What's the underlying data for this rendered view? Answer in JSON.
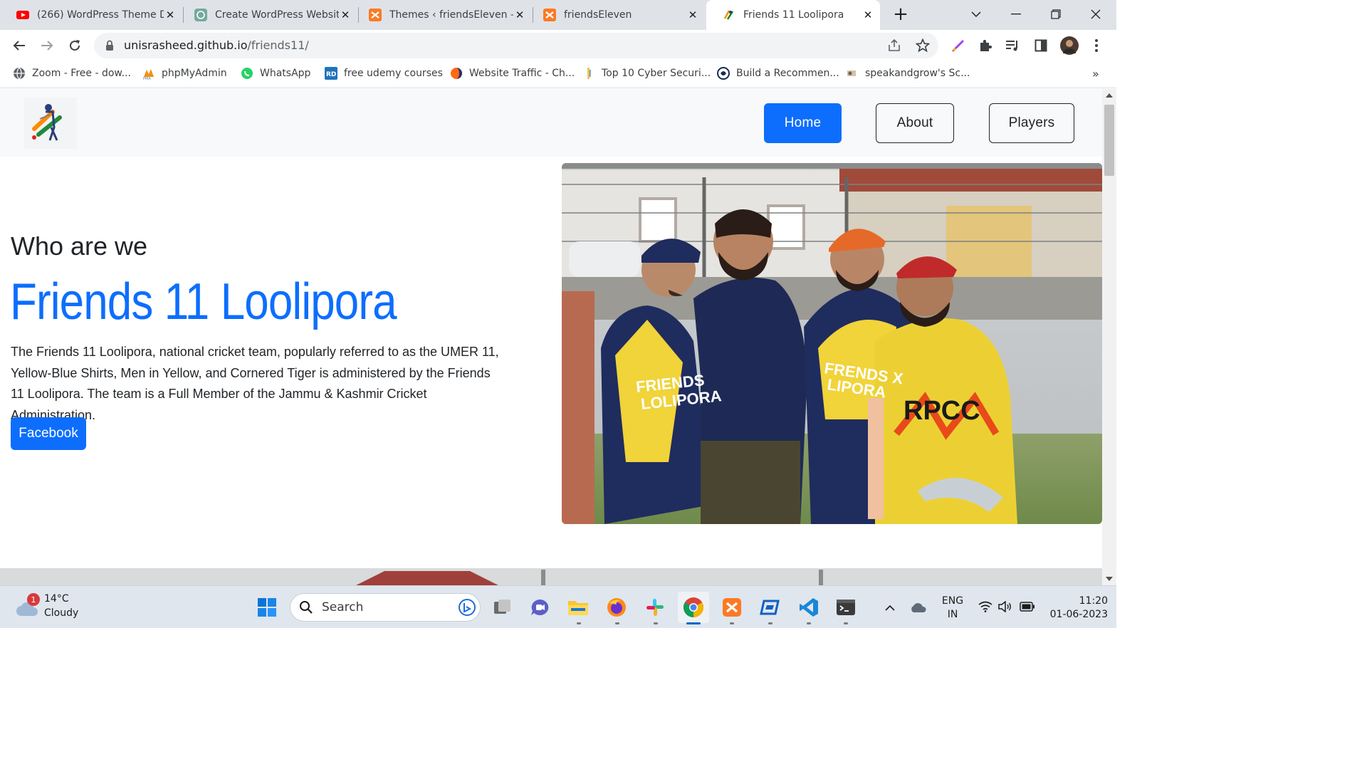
{
  "browser": {
    "tabs": [
      {
        "title": "(266) WordPress Theme D",
        "icon": "youtube-icon",
        "active": false
      },
      {
        "title": "Create WordPress Websit",
        "icon": "chatgpt-icon",
        "active": false
      },
      {
        "title": "Themes ‹ friendsEleven —",
        "icon": "xampp-icon",
        "active": false
      },
      {
        "title": "friendsEleven",
        "icon": "xampp-icon",
        "active": false
      },
      {
        "title": "Friends 11 Loolipora",
        "icon": "cricket-logo-icon",
        "active": true
      }
    ],
    "url_host": "unisrasheed.github.io",
    "url_path": "/friends11/",
    "bookmarks": [
      {
        "label": "Zoom - Free - dow...",
        "icon": "globe-icon"
      },
      {
        "label": "phpMyAdmin",
        "icon": "phpmyadmin-icon"
      },
      {
        "label": "WhatsApp",
        "icon": "whatsapp-icon"
      },
      {
        "label": "free udemy courses",
        "icon": "rd-icon"
      },
      {
        "label": "Website Traffic - Ch...",
        "icon": "traffic-icon"
      },
      {
        "label": "Top 10 Cyber Securi...",
        "icon": "bookmark-icon"
      },
      {
        "label": "Build a Recommen...",
        "icon": "codepen-icon"
      },
      {
        "label": "speakandgrow's Sc...",
        "icon": "speak-icon"
      }
    ],
    "bookmarks_more": "»"
  },
  "site": {
    "nav": {
      "home": "Home",
      "about": "About",
      "players": "Players"
    },
    "hero": {
      "subtitle": "Who are we",
      "title": "Friends 11 Loolipora",
      "description": "The Friends 11 Loolipora, national cricket team, popularly referred to as the UMER 11, Yellow-Blue Shirts, Men in Yellow, and Cornered Tiger is administered by the Friends 11 Loolipora. The team is a Full Member of the Jammu & Kashmir Cricket Administration.",
      "button": "Facebook"
    },
    "photo_text": {
      "jersey_left": "FRIENDS\nLOLIPORA",
      "jersey_mid": "FRENDS X\nLIPORA",
      "jersey_right": "RPCC"
    },
    "colors": {
      "primary": "#0d6efd",
      "text": "#212529",
      "navbar_bg": "#f8f9fa"
    }
  },
  "taskbar": {
    "weather_temp": "14°C",
    "weather_desc": "Cloudy",
    "weather_badge": "1",
    "search_label": "Search",
    "lang_top": "ENG",
    "lang_bottom": "IN",
    "time": "11:20",
    "date": "01-06-2023"
  }
}
